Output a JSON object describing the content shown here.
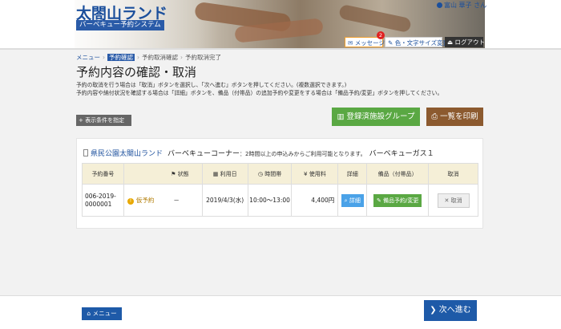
{
  "header": {
    "site_title": "太閤山ランド",
    "site_subtitle": "バーベキュー予約システム",
    "user_name": "富山 華子 さん",
    "message_label": "メッセージ",
    "message_count": "2",
    "color_size_label": "色・文字サイズ変更",
    "logout_label": "ログアウト"
  },
  "breadcrumb": {
    "items": [
      "メニュー",
      "予約確認",
      "予約取消確認",
      "予約取消完了"
    ]
  },
  "page": {
    "title": "予約内容の確認・取消",
    "desc_line1": "予約の取消を行う場合は「取消」ボタンを選択し、「次へ進む」ボタンを押してください。(複数選択できます。)",
    "desc_line2": "予約内容や納付状況を確認する場合は「詳細」ボタンを、備品（付帯品）の追加予約や変更をする場合は「備品予約/変更」ボタンを押してください。"
  },
  "actions": {
    "filter_label": "+ 表示条件を指定",
    "registered_group_label": "登録済施設グループ",
    "print_label": "一覧を印刷"
  },
  "reservation": {
    "facility_name": "県民公園太閤山ランド",
    "room_name": "バーベキューコーナー",
    "room_note": "：2時間以上の申込みからご利用可能となります。",
    "equipment_name": "バーベキューガス１",
    "columns": [
      "予約番号",
      "状態",
      "利用日",
      "時間帯",
      "使用料",
      "詳細",
      "備品（付帯品）",
      "取消"
    ],
    "row": {
      "number": "006-2019-0000001",
      "status": "仮予約",
      "dash": "－",
      "date": "2019/4/3(水)",
      "time": "10:00～13:00",
      "fee": "4,400円",
      "detail_label": "詳細",
      "equip_label": "備品予約/変更",
      "cancel_label": "取消"
    }
  },
  "footer": {
    "menu_label": "メニュー",
    "next_label": "次へ進む"
  },
  "colors": {
    "primary": "#1e5aa8",
    "green": "#5aa843",
    "brown": "#8c5a2f",
    "table_header": "#f5efd7"
  }
}
